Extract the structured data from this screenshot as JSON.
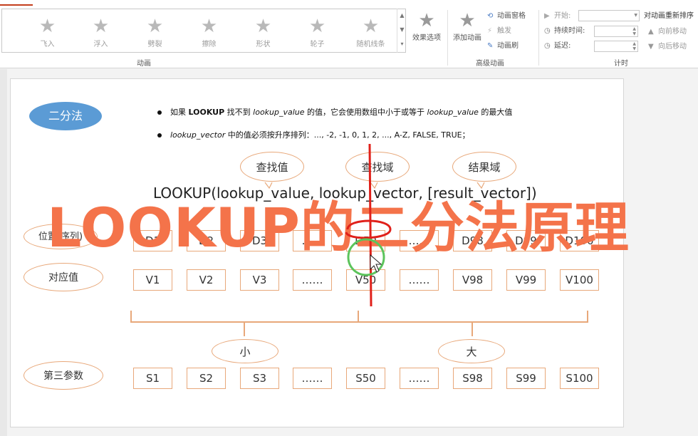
{
  "ribbon": {
    "effects": [
      {
        "label": "飞入",
        "icon": "star-fly-in-icon"
      },
      {
        "label": "浮入",
        "icon": "star-float-in-icon"
      },
      {
        "label": "劈裂",
        "icon": "star-split-icon"
      },
      {
        "label": "擦除",
        "icon": "star-wipe-icon"
      },
      {
        "label": "形状",
        "icon": "star-shape-icon"
      },
      {
        "label": "轮子",
        "icon": "star-wheel-icon"
      },
      {
        "label": "随机线条",
        "icon": "star-random-bars-icon"
      }
    ],
    "effect_options_label": "效果选项",
    "animation_group_label": "动画",
    "add_animation_label": "添加动画",
    "animation_pane_label": "动画窗格",
    "trigger_label": "触发",
    "animation_painter_label": "动画刷",
    "advanced_group_label": "高级动画",
    "start_label": "开始:",
    "duration_label": "持续时间:",
    "delay_label": "延迟:",
    "reorder_label": "对动画重新排序",
    "move_earlier_label": "向前移动",
    "move_later_label": "向后移动",
    "timing_group_label": "计时"
  },
  "slide": {
    "badge": "二分法",
    "bullet1_pre": "如果 ",
    "bullet1_b1": "LOOKUP",
    "bullet1_mid1": " 找不到 ",
    "bullet1_i1": "lookup_value",
    "bullet1_mid2": " 的值，它会使用数组中小于或等于 ",
    "bullet1_i2": "lookup_value",
    "bullet1_post": " 的最大值",
    "bullet2_i": "lookup_vector",
    "bullet2_text": " 中的值必须按升序排列：..., -2, -1, 0, 1, 2, ..., A-Z, FALSE, TRUE；",
    "callout_lookup_value": "查找值",
    "callout_lookup_vector": "查找域",
    "callout_result": "结果域",
    "formula": "LOOKUP(lookup_value, lookup_vector, [result_vector])",
    "row1_label": "位置(序列)",
    "row1": [
      "D1",
      "D2",
      "D3",
      "……",
      "D50",
      "……",
      "D98",
      "D99",
      "D100"
    ],
    "row2_label": "对应值",
    "row2": [
      "V1",
      "V2",
      "V3",
      "……",
      "V50",
      "……",
      "V98",
      "V99",
      "V100"
    ],
    "small_label": "小",
    "big_label": "大",
    "row3_label": "第三参数",
    "row3": [
      "S1",
      "S2",
      "S3",
      "……",
      "S50",
      "……",
      "S98",
      "S99",
      "S100"
    ],
    "overlay_title": "LOOKUP的二分法原理"
  },
  "colors": {
    "accent_orange": "#f4734a",
    "badge_blue": "#5b9bd5",
    "box_border": "#e8a87a",
    "red_mark": "#e0201a",
    "cursor_green": "#5cc45c"
  }
}
